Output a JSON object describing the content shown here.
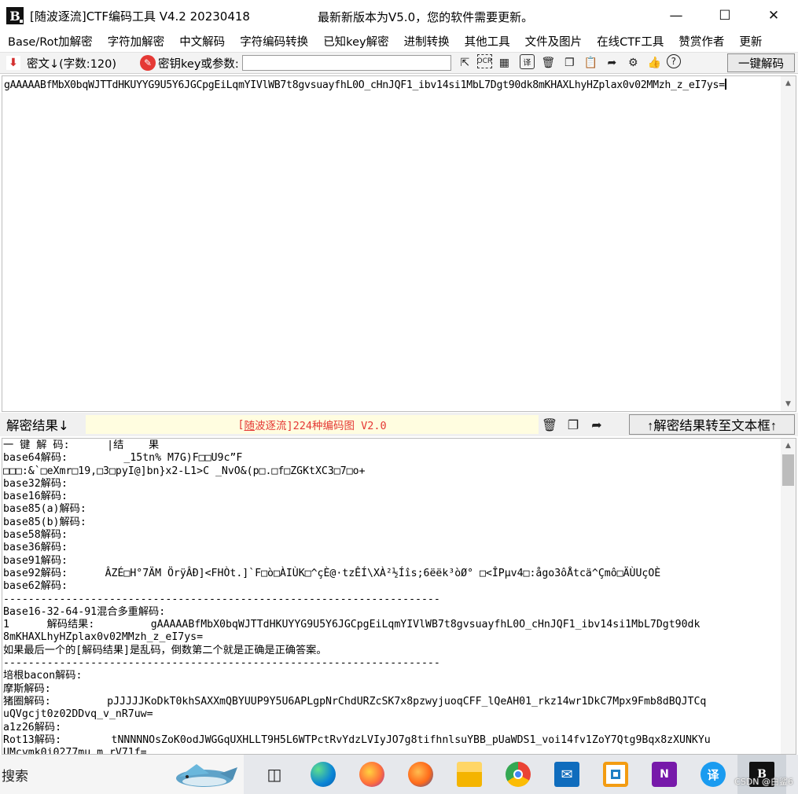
{
  "window": {
    "title": "[随波逐流]CTF编码工具 V4.2 20230418",
    "update_notice": "最新新版本为V5.0，您的软件需要更新。",
    "logo_letter": "B"
  },
  "menu": [
    "Base/Rot加解密",
    "字符加解密",
    "中文解码",
    "字符编码转换",
    "已知key解密",
    "进制转换",
    "其他工具",
    "文件及图片",
    "在线CTF工具",
    "赞赏作者",
    "更新"
  ],
  "toolbar": {
    "cipher_label": "密文↓(字数:120)",
    "key_label": "密钥key或参数:",
    "key_value": "",
    "decode_button": "一键解码",
    "tool_icons": [
      "cursor-icon",
      "ocr-icon",
      "qr-icon",
      "translate-icon",
      "trash-icon",
      "copy-icon",
      "paste-icon",
      "share-icon",
      "gear-icon",
      "like-icon",
      "help-icon"
    ]
  },
  "cipher_text": "gAAAAABfMbX0bqWJTTdHKUYYG9U5Y6JGCpgEiLqmYIVlWB7t8gvsuayfhL0O_cHnJQF1_ibv14si1MbL7Dgt90dk8mKHAXLhyHZplax0v02MMzh_z_eI7ys=",
  "result_bar": {
    "label": "解密结果↓",
    "banner_prefix": "[",
    "banner_u": "随",
    "banner_suffix": "波逐流]224种编码图 V2.0",
    "to_text_button": "↑解密结果转至文本框↑"
  },
  "result_lines": [
    "一 键 解 码:      |结    果",
    "base64解码:         _15tn% M7G)F□□U9c”F",
    "□□□:&`□eXmr□19,□3□pyI@]bn}x2-L1>C _NvO&(p□.□f□ZGKtXC3□7□o+",
    "base32解码:",
    "base16解码:",
    "base85(a)解码:",
    "base85(b)解码:",
    "base58解码:",
    "base36解码:",
    "base91解码:",
    "base92解码:      ÂZÉ□H°7ÄM ÖrÿÂÐ]<FHÒt.]`F□ò□ÀIÙK□^çÈ@·tzÊÍ\\XÀ²½Íîs;6ëëk³òØ° □<ÎPµv4□:ågo3ôÅtcä^Çmô□ÄÙUçOÈ",
    "base62解码:",
    "----------------------------------------------------------------------",
    "Base16-32-64-91混合多重解码:",
    "1      解码结果:         gAAAAABfMbX0bqWJTTdHKUYYG9U5Y6JGCpgEiLqmYIVlWB7t8gvsuayfhL0O_cHnJQF1_ibv14si1MbL7Dgt90dk",
    "8mKHAXLhyHZplax0v02MMzh_z_eI7ys=",
    "如果最后一个的[解码结果]是乱码，倒数第二个就是正确是正确答案。",
    "----------------------------------------------------------------------",
    "培根bacon解码:",
    "摩斯解码:",
    "猪圈解码:         pJJJJJKoDkT0khSAXXmQBYUUP9Y5U6APLgpNrChdURZcSK7x8pzwyjuoqCFF_lQeAH01_rkz14wr1DkC7Mpx9Fmb8dBQJTCq",
    "uQVgcjt0z02DDvq_v_nR7uw=",
    "a1z26解码:",
    "Rot13解码:        tNNNNNOsZoK0odJWGGqUXHLLT9H5L6WTPctRvYdzLVIyJO7g8tifhnlsuYBB_pUaWDS1_voi14fv1ZoY7Qtg9Bqx8zXUNKYu",
    "UMcymk0i0277mu m rV71f="
  ],
  "taskbar": {
    "search_label": "搜索",
    "apps": [
      "task-view-icon",
      "edge-icon",
      "firefox-icon",
      "firefox-dev-icon",
      "file-explorer-icon",
      "chrome-icon",
      "mail-icon",
      "vmware-icon",
      "onenote-icon",
      "translate-app-icon",
      "ctf-tool-icon"
    ],
    "watermark": "CSDN @白鲨6"
  }
}
